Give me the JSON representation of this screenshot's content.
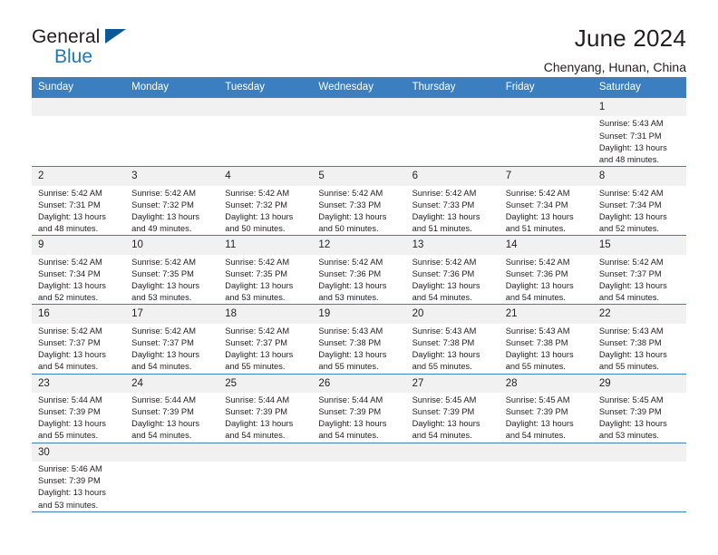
{
  "brand": {
    "name_top": "General",
    "name_bottom": "Blue",
    "triangle_color": "#0c5997",
    "blue_text_color": "#2077b8"
  },
  "header": {
    "title": "June 2024",
    "subtitle": "Chenyang, Hunan, China"
  },
  "colors": {
    "header_row_bg": "#3c7fc1",
    "header_row_text": "#ffffff",
    "daynum_bg": "#f1f1f1",
    "grid_line": "#3c7fc1",
    "body_text": "#231f20"
  },
  "labels": {
    "sunrise_prefix": "Sunrise:",
    "sunset_prefix": "Sunset:",
    "daylight_prefix": "Daylight:"
  },
  "weekday_headers": [
    "Sunday",
    "Monday",
    "Tuesday",
    "Wednesday",
    "Thursday",
    "Friday",
    "Saturday"
  ],
  "weeks": [
    [
      {
        "day": "",
        "lines": []
      },
      {
        "day": "",
        "lines": []
      },
      {
        "day": "",
        "lines": []
      },
      {
        "day": "",
        "lines": []
      },
      {
        "day": "",
        "lines": []
      },
      {
        "day": "",
        "lines": []
      },
      {
        "day": "1",
        "lines": [
          "Sunrise: 5:43 AM",
          "Sunset: 7:31 PM",
          "Daylight: 13 hours",
          "and 48 minutes."
        ]
      }
    ],
    [
      {
        "day": "2",
        "lines": [
          "Sunrise: 5:42 AM",
          "Sunset: 7:31 PM",
          "Daylight: 13 hours",
          "and 48 minutes."
        ]
      },
      {
        "day": "3",
        "lines": [
          "Sunrise: 5:42 AM",
          "Sunset: 7:32 PM",
          "Daylight: 13 hours",
          "and 49 minutes."
        ]
      },
      {
        "day": "4",
        "lines": [
          "Sunrise: 5:42 AM",
          "Sunset: 7:32 PM",
          "Daylight: 13 hours",
          "and 50 minutes."
        ]
      },
      {
        "day": "5",
        "lines": [
          "Sunrise: 5:42 AM",
          "Sunset: 7:33 PM",
          "Daylight: 13 hours",
          "and 50 minutes."
        ]
      },
      {
        "day": "6",
        "lines": [
          "Sunrise: 5:42 AM",
          "Sunset: 7:33 PM",
          "Daylight: 13 hours",
          "and 51 minutes."
        ]
      },
      {
        "day": "7",
        "lines": [
          "Sunrise: 5:42 AM",
          "Sunset: 7:34 PM",
          "Daylight: 13 hours",
          "and 51 minutes."
        ]
      },
      {
        "day": "8",
        "lines": [
          "Sunrise: 5:42 AM",
          "Sunset: 7:34 PM",
          "Daylight: 13 hours",
          "and 52 minutes."
        ]
      }
    ],
    [
      {
        "day": "9",
        "lines": [
          "Sunrise: 5:42 AM",
          "Sunset: 7:34 PM",
          "Daylight: 13 hours",
          "and 52 minutes."
        ]
      },
      {
        "day": "10",
        "lines": [
          "Sunrise: 5:42 AM",
          "Sunset: 7:35 PM",
          "Daylight: 13 hours",
          "and 53 minutes."
        ]
      },
      {
        "day": "11",
        "lines": [
          "Sunrise: 5:42 AM",
          "Sunset: 7:35 PM",
          "Daylight: 13 hours",
          "and 53 minutes."
        ]
      },
      {
        "day": "12",
        "lines": [
          "Sunrise: 5:42 AM",
          "Sunset: 7:36 PM",
          "Daylight: 13 hours",
          "and 53 minutes."
        ]
      },
      {
        "day": "13",
        "lines": [
          "Sunrise: 5:42 AM",
          "Sunset: 7:36 PM",
          "Daylight: 13 hours",
          "and 54 minutes."
        ]
      },
      {
        "day": "14",
        "lines": [
          "Sunrise: 5:42 AM",
          "Sunset: 7:36 PM",
          "Daylight: 13 hours",
          "and 54 minutes."
        ]
      },
      {
        "day": "15",
        "lines": [
          "Sunrise: 5:42 AM",
          "Sunset: 7:37 PM",
          "Daylight: 13 hours",
          "and 54 minutes."
        ]
      }
    ],
    [
      {
        "day": "16",
        "lines": [
          "Sunrise: 5:42 AM",
          "Sunset: 7:37 PM",
          "Daylight: 13 hours",
          "and 54 minutes."
        ]
      },
      {
        "day": "17",
        "lines": [
          "Sunrise: 5:42 AM",
          "Sunset: 7:37 PM",
          "Daylight: 13 hours",
          "and 54 minutes."
        ]
      },
      {
        "day": "18",
        "lines": [
          "Sunrise: 5:42 AM",
          "Sunset: 7:37 PM",
          "Daylight: 13 hours",
          "and 55 minutes."
        ]
      },
      {
        "day": "19",
        "lines": [
          "Sunrise: 5:43 AM",
          "Sunset: 7:38 PM",
          "Daylight: 13 hours",
          "and 55 minutes."
        ]
      },
      {
        "day": "20",
        "lines": [
          "Sunrise: 5:43 AM",
          "Sunset: 7:38 PM",
          "Daylight: 13 hours",
          "and 55 minutes."
        ]
      },
      {
        "day": "21",
        "lines": [
          "Sunrise: 5:43 AM",
          "Sunset: 7:38 PM",
          "Daylight: 13 hours",
          "and 55 minutes."
        ]
      },
      {
        "day": "22",
        "lines": [
          "Sunrise: 5:43 AM",
          "Sunset: 7:38 PM",
          "Daylight: 13 hours",
          "and 55 minutes."
        ]
      }
    ],
    [
      {
        "day": "23",
        "lines": [
          "Sunrise: 5:44 AM",
          "Sunset: 7:39 PM",
          "Daylight: 13 hours",
          "and 55 minutes."
        ]
      },
      {
        "day": "24",
        "lines": [
          "Sunrise: 5:44 AM",
          "Sunset: 7:39 PM",
          "Daylight: 13 hours",
          "and 54 minutes."
        ]
      },
      {
        "day": "25",
        "lines": [
          "Sunrise: 5:44 AM",
          "Sunset: 7:39 PM",
          "Daylight: 13 hours",
          "and 54 minutes."
        ]
      },
      {
        "day": "26",
        "lines": [
          "Sunrise: 5:44 AM",
          "Sunset: 7:39 PM",
          "Daylight: 13 hours",
          "and 54 minutes."
        ]
      },
      {
        "day": "27",
        "lines": [
          "Sunrise: 5:45 AM",
          "Sunset: 7:39 PM",
          "Daylight: 13 hours",
          "and 54 minutes."
        ]
      },
      {
        "day": "28",
        "lines": [
          "Sunrise: 5:45 AM",
          "Sunset: 7:39 PM",
          "Daylight: 13 hours",
          "and 54 minutes."
        ]
      },
      {
        "day": "29",
        "lines": [
          "Sunrise: 5:45 AM",
          "Sunset: 7:39 PM",
          "Daylight: 13 hours",
          "and 53 minutes."
        ]
      }
    ],
    [
      {
        "day": "30",
        "lines": [
          "Sunrise: 5:46 AM",
          "Sunset: 7:39 PM",
          "Daylight: 13 hours",
          "and 53 minutes."
        ]
      },
      {
        "day": "",
        "lines": []
      },
      {
        "day": "",
        "lines": []
      },
      {
        "day": "",
        "lines": []
      },
      {
        "day": "",
        "lines": []
      },
      {
        "day": "",
        "lines": []
      },
      {
        "day": "",
        "lines": []
      }
    ]
  ]
}
